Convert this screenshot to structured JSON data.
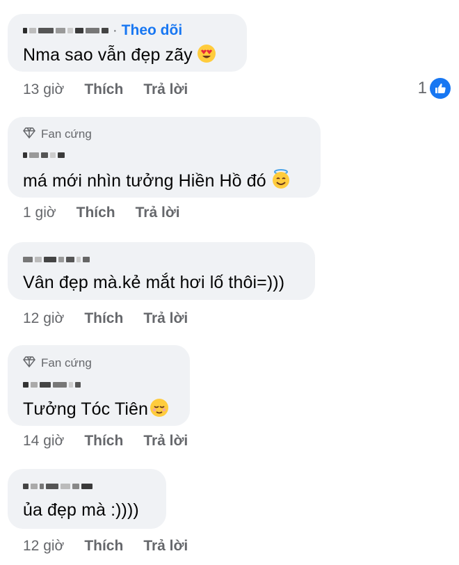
{
  "comments": [
    {
      "author_label": "",
      "follow_label": "Theo dõi",
      "badge": "",
      "text": "Nma sao vẫn đẹp zãy",
      "emoji_icon": "heart-eyes-emoji",
      "time": "13 giờ",
      "like_label": "Thích",
      "reply_label": "Trả lời",
      "reaction_count": "1"
    },
    {
      "badge": "Fan cứng",
      "text": "má mới nhìn tưởng Hiền Hồ đó",
      "emoji_icon": "halo-smile-emoji",
      "time": "1 giờ",
      "like_label": "Thích",
      "reply_label": "Trả lời"
    },
    {
      "text": "Vân đẹp mà.kẻ mắt hơi lố thôi=)))",
      "time": "12 giờ",
      "like_label": "Thích",
      "reply_label": "Trả lời"
    },
    {
      "badge": "Fan cứng",
      "text": "Tưởng Tóc Tiên",
      "emoji_icon": "relieved-face-emoji",
      "time": "14 giờ",
      "like_label": "Thích",
      "reply_label": "Trả lời"
    },
    {
      "text": "ủa đẹp mà :))))",
      "time": "12 giờ",
      "like_label": "Thích",
      "reply_label": "Trả lời"
    }
  ],
  "colors": {
    "bubble": "#f0f2f5",
    "link_blue": "#1877f2",
    "meta_gray": "#65676b",
    "text": "#050505"
  }
}
